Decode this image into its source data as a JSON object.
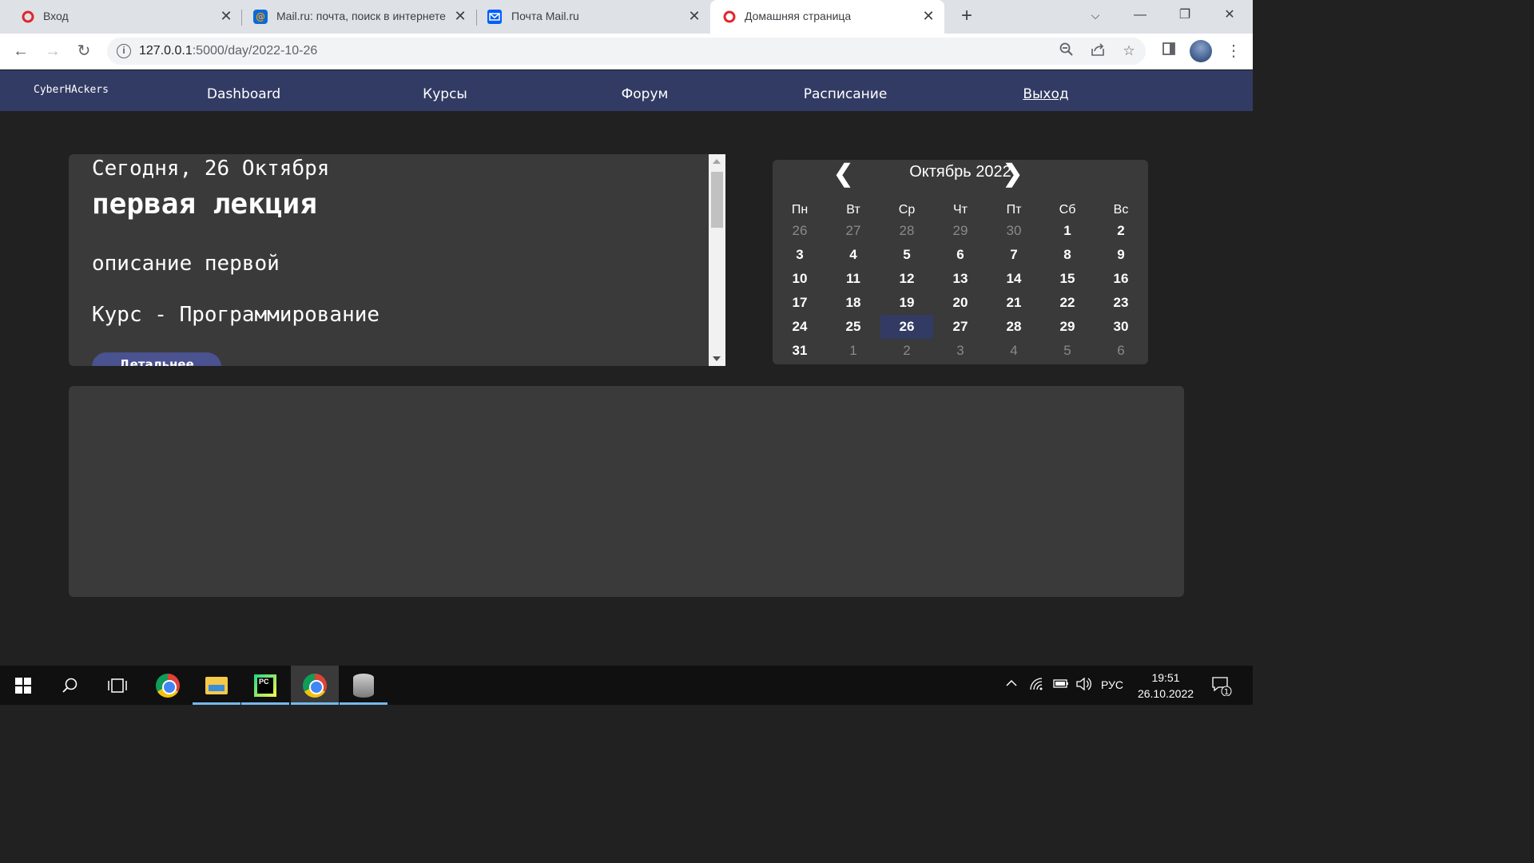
{
  "browser": {
    "tabs": [
      {
        "title": "Вход",
        "active": false
      },
      {
        "title": "Mail.ru: почта, поиск в интернете",
        "active": false
      },
      {
        "title": "Почта Mail.ru",
        "active": false
      },
      {
        "title": "Домашняя страница",
        "active": true
      }
    ],
    "url_host": "127.0.0.1",
    "url_path": ":5000/day/2022-10-26"
  },
  "site": {
    "logo": "CyberHAckers",
    "nav": [
      "Dashboard",
      "Курсы",
      "Форум",
      "Расписание",
      "Выход"
    ]
  },
  "day": {
    "date_label": "Сегодня, 26 Октября",
    "lecture_title": "первая лекция",
    "description": "описание первой",
    "course": "Курс - Программирование",
    "details_button": "Детальнее"
  },
  "calendar": {
    "title": "Октябрь 2022",
    "prev": "❮",
    "next": "❯",
    "weekdays": [
      "Пн",
      "Вт",
      "Ср",
      "Чт",
      "Пт",
      "Сб",
      "Вс"
    ],
    "weeks": [
      [
        {
          "d": "26",
          "o": true
        },
        {
          "d": "27",
          "o": true
        },
        {
          "d": "28",
          "o": true
        },
        {
          "d": "29",
          "o": true
        },
        {
          "d": "30",
          "o": true
        },
        {
          "d": "1"
        },
        {
          "d": "2"
        }
      ],
      [
        {
          "d": "3"
        },
        {
          "d": "4"
        },
        {
          "d": "5"
        },
        {
          "d": "6"
        },
        {
          "d": "7"
        },
        {
          "d": "8"
        },
        {
          "d": "9"
        }
      ],
      [
        {
          "d": "10"
        },
        {
          "d": "11"
        },
        {
          "d": "12"
        },
        {
          "d": "13"
        },
        {
          "d": "14"
        },
        {
          "d": "15"
        },
        {
          "d": "16"
        }
      ],
      [
        {
          "d": "17"
        },
        {
          "d": "18"
        },
        {
          "d": "19"
        },
        {
          "d": "20"
        },
        {
          "d": "21"
        },
        {
          "d": "22"
        },
        {
          "d": "23"
        }
      ],
      [
        {
          "d": "24"
        },
        {
          "d": "25"
        },
        {
          "d": "26",
          "today": true
        },
        {
          "d": "27"
        },
        {
          "d": "28"
        },
        {
          "d": "29"
        },
        {
          "d": "30"
        }
      ],
      [
        {
          "d": "31"
        },
        {
          "d": "1",
          "o": true
        },
        {
          "d": "2",
          "o": true
        },
        {
          "d": "3",
          "o": true
        },
        {
          "d": "4",
          "o": true
        },
        {
          "d": "5",
          "o": true
        },
        {
          "d": "6",
          "o": true
        }
      ]
    ]
  },
  "taskbar": {
    "lang": "РУС",
    "time": "19:51",
    "date": "26.10.2022",
    "notifications": "1"
  },
  "colors": {
    "nav_bg": "#323b63",
    "page_bg": "#212121",
    "panel_bg": "#3a3a3a",
    "button": "#4a528f",
    "today": "#323b63"
  }
}
